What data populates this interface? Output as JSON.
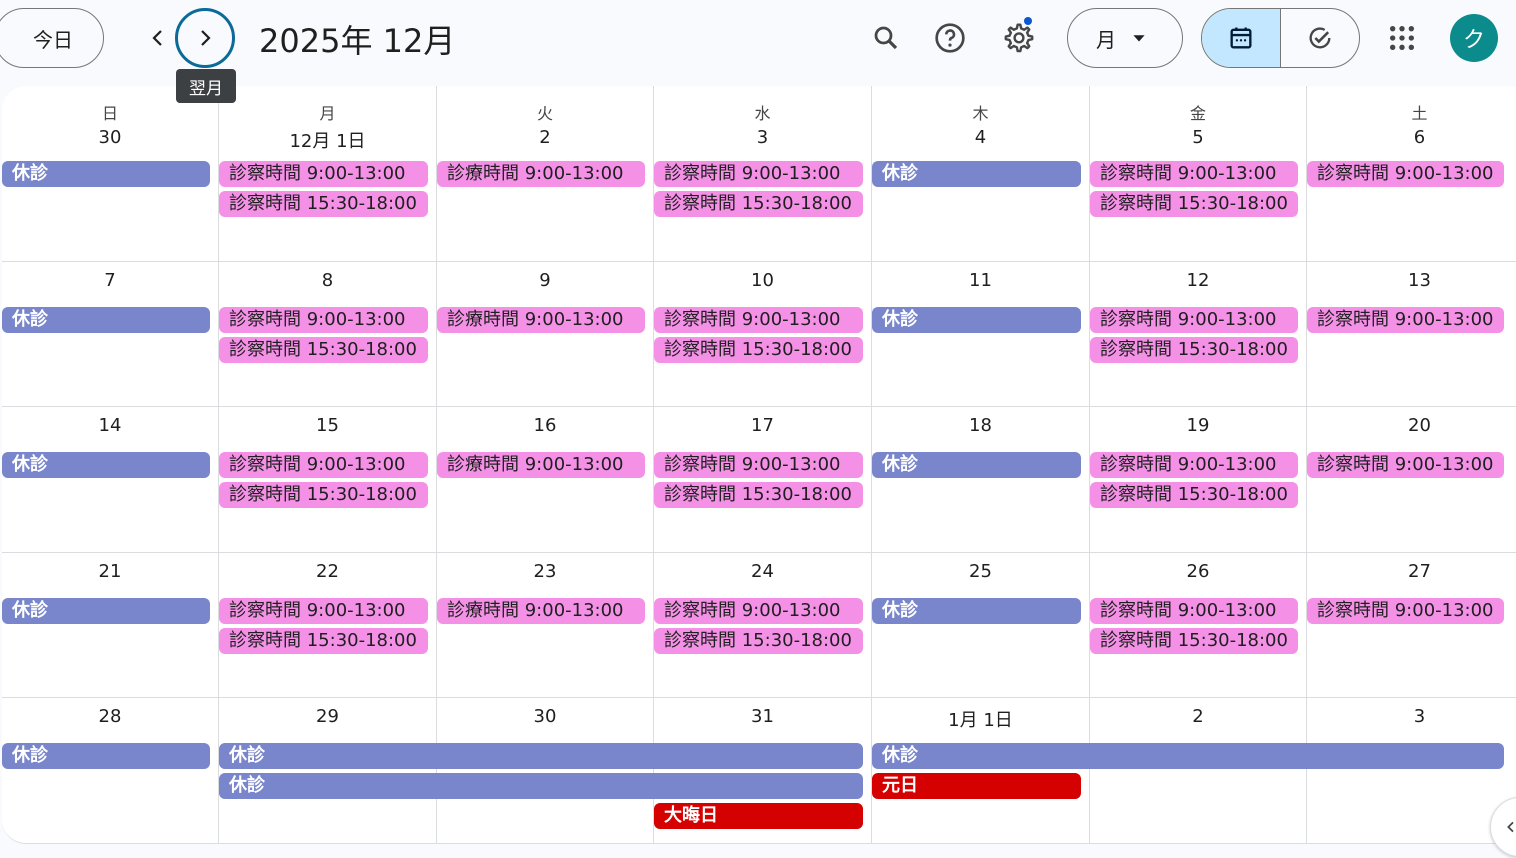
{
  "header": {
    "today_label": "今日",
    "prev_icon": "chevron-left-icon",
    "next_icon": "chevron-right-icon",
    "next_tooltip": "翌月",
    "month_title": "2025年 12月",
    "view_label": "月",
    "avatar_letter": "ク",
    "settings_dot_color": "#0b57d0",
    "avatar_color": "#0b8b8b"
  },
  "weekdays": [
    "日",
    "月",
    "火",
    "水",
    "木",
    "金",
    "土"
  ],
  "colors": {
    "off": "#7986cb",
    "hours": "#f491e6",
    "holiday": "#d50000"
  },
  "weeks": [
    {
      "days": [
        "30",
        "12月 1日",
        "2",
        "3",
        "4",
        "5",
        "6"
      ],
      "events": [
        {
          "start": 0,
          "span": 1,
          "row": 0,
          "kind": "off",
          "title": "休診"
        },
        {
          "start": 1,
          "span": 1,
          "row": 0,
          "kind": "hours",
          "title": "診察時間 9:00-13:00"
        },
        {
          "start": 1,
          "span": 1,
          "row": 1,
          "kind": "hours",
          "title": "診察時間 15:30-18:00"
        },
        {
          "start": 2,
          "span": 1,
          "row": 0,
          "kind": "hours",
          "title": "診療時間 9:00-13:00"
        },
        {
          "start": 3,
          "span": 1,
          "row": 0,
          "kind": "hours",
          "title": "診察時間 9:00-13:00"
        },
        {
          "start": 3,
          "span": 1,
          "row": 1,
          "kind": "hours",
          "title": "診察時間 15:30-18:00"
        },
        {
          "start": 4,
          "span": 1,
          "row": 0,
          "kind": "off",
          "title": "休診"
        },
        {
          "start": 5,
          "span": 1,
          "row": 0,
          "kind": "hours",
          "title": "診察時間 9:00-13:00"
        },
        {
          "start": 5,
          "span": 1,
          "row": 1,
          "kind": "hours",
          "title": "診察時間 15:30-18:00"
        },
        {
          "start": 6,
          "span": 1,
          "row": 0,
          "kind": "hours",
          "title": "診察時間 9:00-13:00"
        }
      ]
    },
    {
      "days": [
        "7",
        "8",
        "9",
        "10",
        "11",
        "12",
        "13"
      ],
      "events": [
        {
          "start": 0,
          "span": 1,
          "row": 0,
          "kind": "off",
          "title": "休診"
        },
        {
          "start": 1,
          "span": 1,
          "row": 0,
          "kind": "hours",
          "title": "診察時間 9:00-13:00"
        },
        {
          "start": 1,
          "span": 1,
          "row": 1,
          "kind": "hours",
          "title": "診察時間 15:30-18:00"
        },
        {
          "start": 2,
          "span": 1,
          "row": 0,
          "kind": "hours",
          "title": "診療時間 9:00-13:00"
        },
        {
          "start": 3,
          "span": 1,
          "row": 0,
          "kind": "hours",
          "title": "診察時間 9:00-13:00"
        },
        {
          "start": 3,
          "span": 1,
          "row": 1,
          "kind": "hours",
          "title": "診察時間 15:30-18:00"
        },
        {
          "start": 4,
          "span": 1,
          "row": 0,
          "kind": "off",
          "title": "休診"
        },
        {
          "start": 5,
          "span": 1,
          "row": 0,
          "kind": "hours",
          "title": "診察時間 9:00-13:00"
        },
        {
          "start": 5,
          "span": 1,
          "row": 1,
          "kind": "hours",
          "title": "診察時間 15:30-18:00"
        },
        {
          "start": 6,
          "span": 1,
          "row": 0,
          "kind": "hours",
          "title": "診察時間 9:00-13:00"
        }
      ]
    },
    {
      "days": [
        "14",
        "15",
        "16",
        "17",
        "18",
        "19",
        "20"
      ],
      "events": [
        {
          "start": 0,
          "span": 1,
          "row": 0,
          "kind": "off",
          "title": "休診"
        },
        {
          "start": 1,
          "span": 1,
          "row": 0,
          "kind": "hours",
          "title": "診察時間 9:00-13:00"
        },
        {
          "start": 1,
          "span": 1,
          "row": 1,
          "kind": "hours",
          "title": "診察時間 15:30-18:00"
        },
        {
          "start": 2,
          "span": 1,
          "row": 0,
          "kind": "hours",
          "title": "診療時間 9:00-13:00"
        },
        {
          "start": 3,
          "span": 1,
          "row": 0,
          "kind": "hours",
          "title": "診察時間 9:00-13:00"
        },
        {
          "start": 3,
          "span": 1,
          "row": 1,
          "kind": "hours",
          "title": "診察時間 15:30-18:00"
        },
        {
          "start": 4,
          "span": 1,
          "row": 0,
          "kind": "off",
          "title": "休診"
        },
        {
          "start": 5,
          "span": 1,
          "row": 0,
          "kind": "hours",
          "title": "診察時間 9:00-13:00"
        },
        {
          "start": 5,
          "span": 1,
          "row": 1,
          "kind": "hours",
          "title": "診察時間 15:30-18:00"
        },
        {
          "start": 6,
          "span": 1,
          "row": 0,
          "kind": "hours",
          "title": "診察時間 9:00-13:00"
        }
      ]
    },
    {
      "days": [
        "21",
        "22",
        "23",
        "24",
        "25",
        "26",
        "27"
      ],
      "events": [
        {
          "start": 0,
          "span": 1,
          "row": 0,
          "kind": "off",
          "title": "休診"
        },
        {
          "start": 1,
          "span": 1,
          "row": 0,
          "kind": "hours",
          "title": "診察時間 9:00-13:00"
        },
        {
          "start": 1,
          "span": 1,
          "row": 1,
          "kind": "hours",
          "title": "診察時間 15:30-18:00"
        },
        {
          "start": 2,
          "span": 1,
          "row": 0,
          "kind": "hours",
          "title": "診療時間 9:00-13:00"
        },
        {
          "start": 3,
          "span": 1,
          "row": 0,
          "kind": "hours",
          "title": "診察時間 9:00-13:00"
        },
        {
          "start": 3,
          "span": 1,
          "row": 1,
          "kind": "hours",
          "title": "診察時間 15:30-18:00"
        },
        {
          "start": 4,
          "span": 1,
          "row": 0,
          "kind": "off",
          "title": "休診"
        },
        {
          "start": 5,
          "span": 1,
          "row": 0,
          "kind": "hours",
          "title": "診察時間 9:00-13:00"
        },
        {
          "start": 5,
          "span": 1,
          "row": 1,
          "kind": "hours",
          "title": "診察時間 15:30-18:00"
        },
        {
          "start": 6,
          "span": 1,
          "row": 0,
          "kind": "hours",
          "title": "診察時間 9:00-13:00"
        }
      ]
    },
    {
      "days": [
        "28",
        "29",
        "30",
        "31",
        "1月 1日",
        "2",
        "3"
      ],
      "events": [
        {
          "start": 0,
          "span": 1,
          "row": 0,
          "kind": "off",
          "title": "休診"
        },
        {
          "start": 1,
          "span": 3,
          "row": 0,
          "kind": "off",
          "title": "休診"
        },
        {
          "start": 1,
          "span": 3,
          "row": 1,
          "kind": "off",
          "title": "休診"
        },
        {
          "start": 3,
          "span": 1,
          "row": 2,
          "kind": "holiday",
          "title": "大晦日"
        },
        {
          "start": 4,
          "span": 3,
          "row": 0,
          "kind": "off",
          "title": "休診"
        },
        {
          "start": 4,
          "span": 1,
          "row": 1,
          "kind": "holiday",
          "title": "元日"
        }
      ]
    }
  ]
}
